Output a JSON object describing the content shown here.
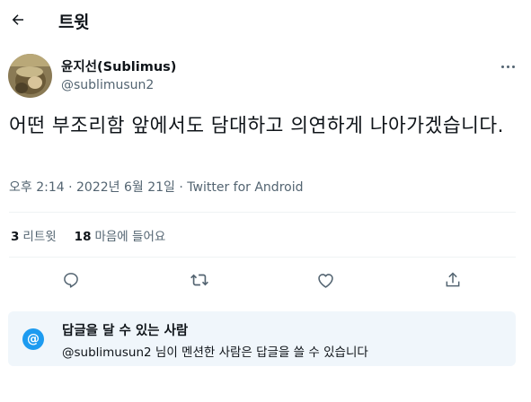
{
  "header": {
    "title": "트윗",
    "back_icon": "arrow-left-icon"
  },
  "tweet": {
    "author": {
      "display_name": "윤지선(Sublimus)",
      "handle": "@sublimusun2"
    },
    "text": "어떤 부조리함 앞에서도 담대하고 의연하게 나아가겠습니다.",
    "meta": {
      "time": "오후 2:14",
      "separator": "·",
      "date": "2022년 6월 21일",
      "source": "Twitter for Android"
    },
    "stats": [
      {
        "count": "3",
        "label": "리트윗"
      },
      {
        "count": "18",
        "label": "마음에 들어요"
      }
    ]
  },
  "actions": [
    {
      "name": "reply",
      "icon": "reply-icon"
    },
    {
      "name": "retweet",
      "icon": "retweet-icon"
    },
    {
      "name": "like",
      "icon": "heart-icon"
    },
    {
      "name": "share",
      "icon": "share-icon"
    }
  ],
  "reply_restriction": {
    "icon": "at-icon",
    "symbol": "@",
    "title": "답글을 달 수 있는 사람",
    "description": "@sublimusun2 님이 멘션한 사람은 답글을 쓸 수 있습니다"
  },
  "colors": {
    "accent": "#1d9bf0",
    "text": "#0f1419",
    "secondary": "#536471",
    "notice_bg": "#f0f6fb"
  }
}
